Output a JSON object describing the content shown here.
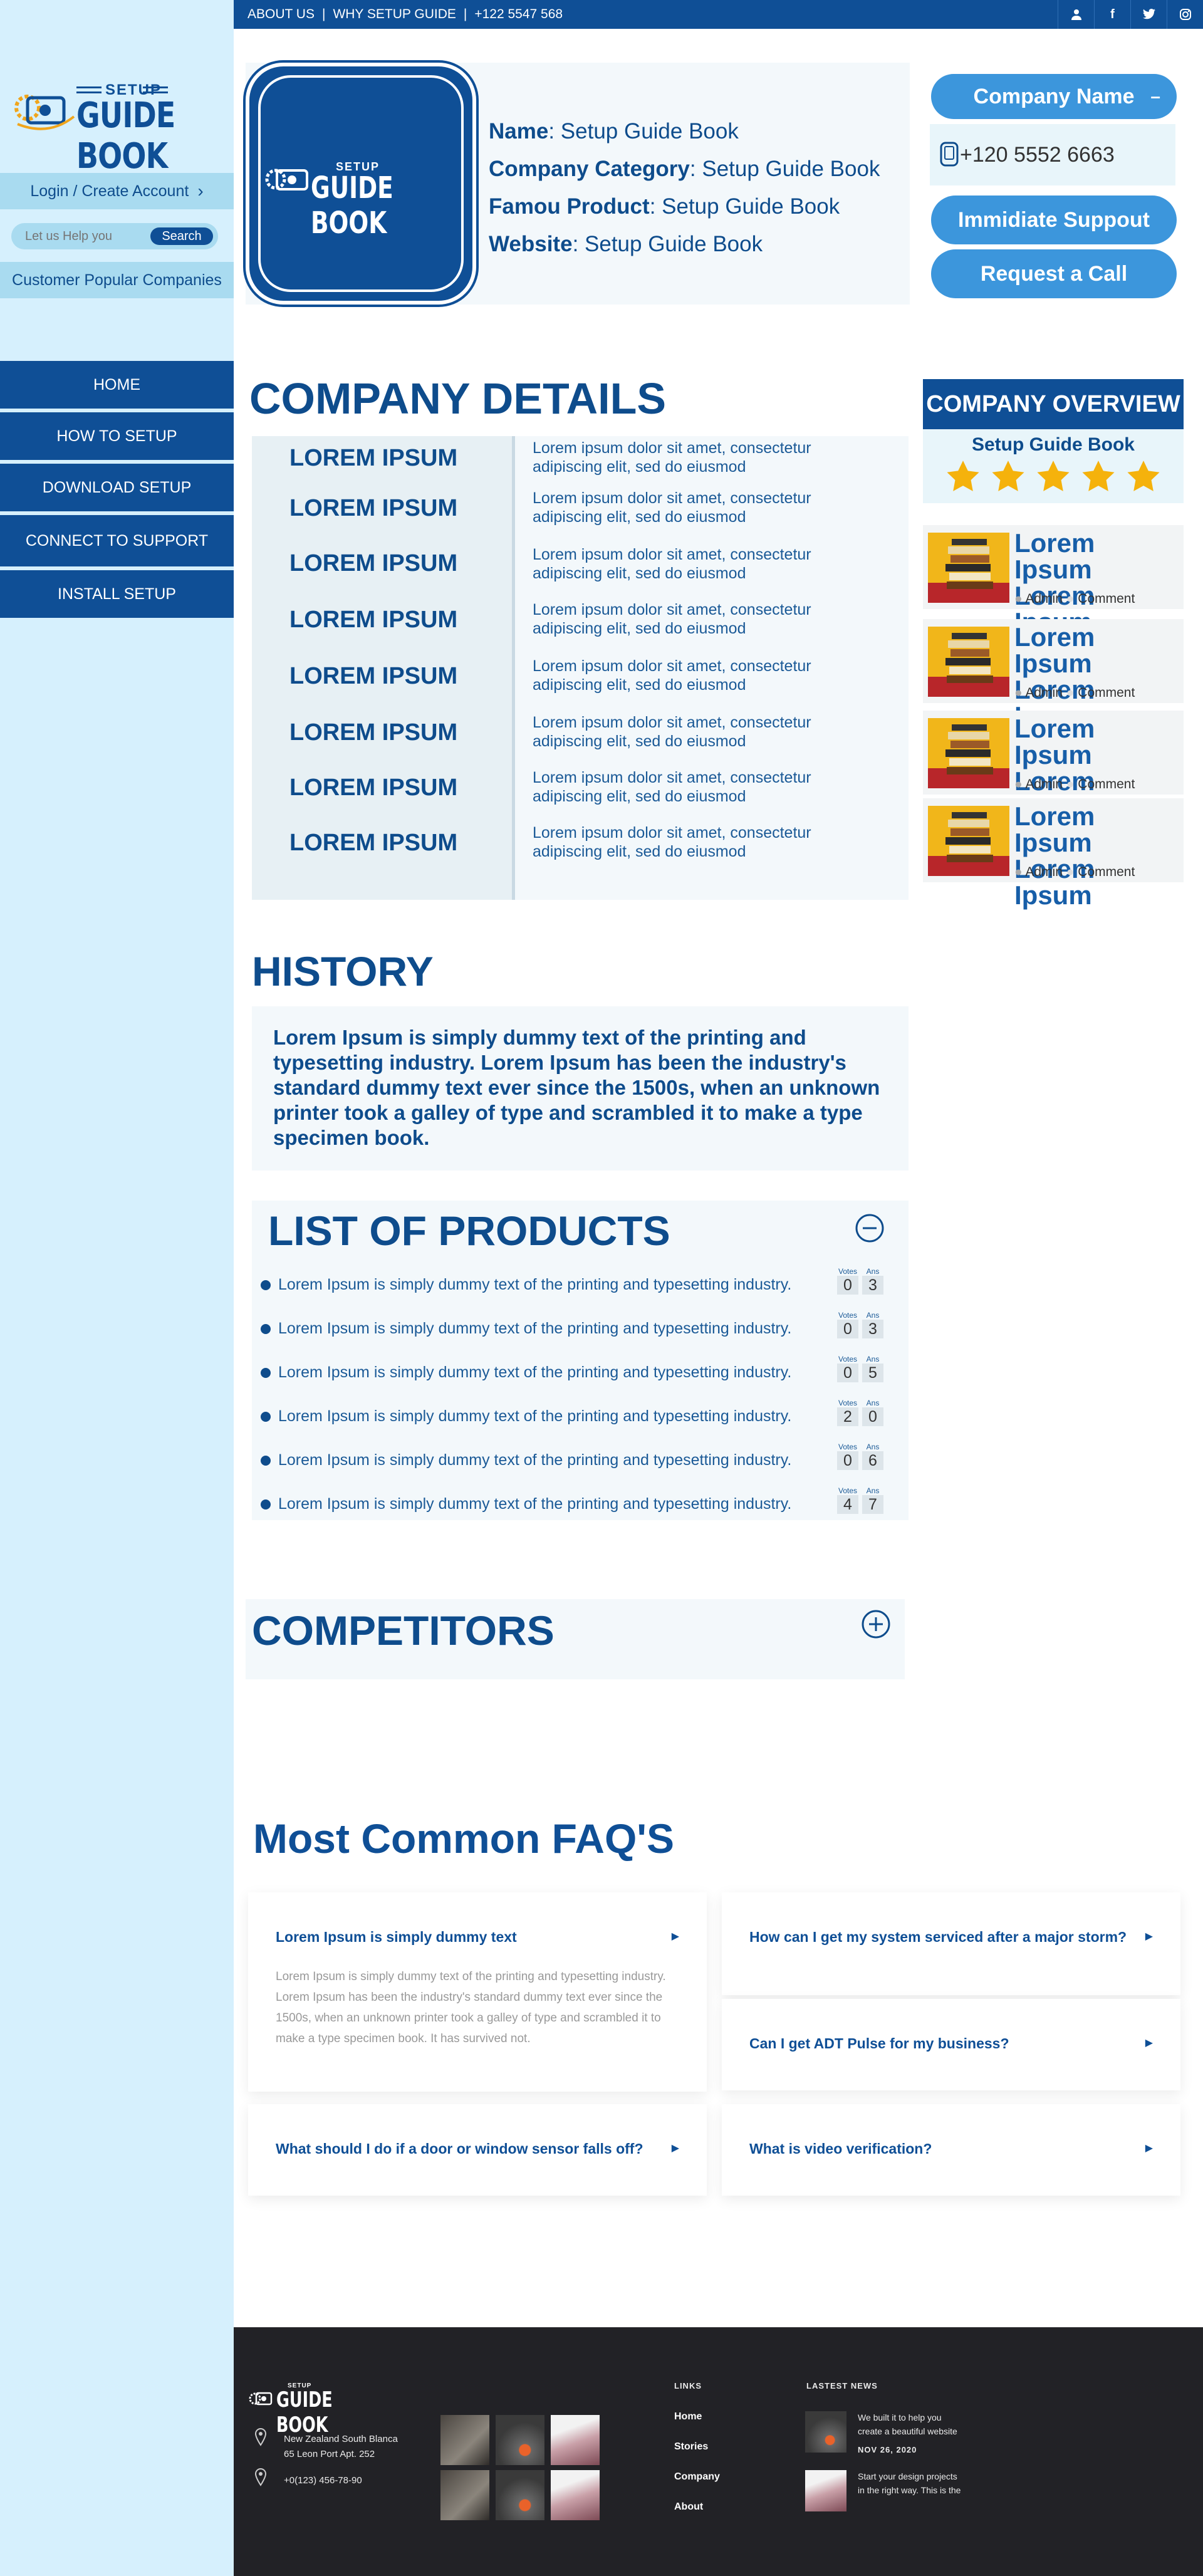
{
  "topbar": {
    "about": "ABOUT US",
    "sep": "|",
    "why": "WHY SETUP GUIDE",
    "phone": "+122 5547 568"
  },
  "brand": {
    "line1": "SETUP",
    "line2": "GUIDE BOOK"
  },
  "sidebar": {
    "login": "Login / Create Account",
    "search_placeholder": "Let us Help you",
    "search_button": "Search",
    "popular": "Customer Popular Companies",
    "nav": [
      "HOME",
      "HOW TO SETUP",
      "DOWNLOAD SETUP",
      "CONNECT TO SUPPORT",
      "INSTALL SETUP"
    ]
  },
  "profile": {
    "name_label": "Name",
    "name": "Setup Guide Book",
    "category_label": "Company Category",
    "category": "Setup Guide Book",
    "product_label": "Famou Product",
    "product": "Setup Guide Book",
    "website_label": "Website",
    "website": "Setup Guide Book"
  },
  "right_panel": {
    "company_name": "Company Name",
    "company_name_toggle": "–",
    "phone": "+120 5552 6663",
    "support_button": "Immidiate Suppout",
    "call_button": "Request a Call"
  },
  "details": {
    "title": "COMPANY DETAILS",
    "rows": [
      {
        "label": "LOREM IPSUM",
        "text": "Lorem ipsum dolor sit amet, consectetur adipiscing elit, sed do eiusmod"
      },
      {
        "label": "LOREM IPSUM",
        "text": "Lorem ipsum dolor sit amet, consectetur adipiscing elit, sed do eiusmod"
      },
      {
        "label": "LOREM IPSUM",
        "text": "Lorem ipsum dolor sit amet, consectetur adipiscing elit, sed do eiusmod"
      },
      {
        "label": "LOREM IPSUM",
        "text": "Lorem ipsum dolor sit amet, consectetur adipiscing elit, sed do eiusmod"
      },
      {
        "label": "LOREM IPSUM",
        "text": "Lorem ipsum dolor sit amet, consectetur adipiscing elit, sed do eiusmod"
      },
      {
        "label": "LOREM IPSUM",
        "text": "Lorem ipsum dolor sit amet, consectetur adipiscing elit, sed do eiusmod"
      },
      {
        "label": "LOREM IPSUM",
        "text": "Lorem ipsum dolor sit amet, consectetur adipiscing elit, sed do eiusmod"
      },
      {
        "label": "LOREM IPSUM",
        "text": "Lorem ipsum dolor sit amet, consectetur adipiscing elit, sed do eiusmod"
      }
    ]
  },
  "overview": {
    "title": "COMPANY OVERVIEW",
    "subtitle": "Setup Guide Book",
    "rating": 5,
    "star_color": "#f5b20c",
    "posts": [
      {
        "title": "Lorem Ipsum Lorem Ipsum",
        "author": "Admin",
        "comment": "Comment"
      },
      {
        "title": "Lorem Ipsum Lorem Ipsum",
        "author": "Admin",
        "comment": "Comment"
      },
      {
        "title": "Lorem Ipsum Lorem Ipsum",
        "author": "Admin",
        "comment": "Comment"
      },
      {
        "title": "Lorem Ipsum Lorem Ipsum",
        "author": "Admin",
        "comment": "Comment"
      }
    ]
  },
  "history": {
    "title": "HISTORY",
    "text": "Lorem Ipsum is simply dummy text of the printing and typesetting industry. Lorem Ipsum has been the industry's standard dummy text ever since the 1500s, when an unknown printer took a galley of type and scrambled it to make a type specimen book."
  },
  "products": {
    "title": "LIST OF PRODUCTS",
    "votes_label": "Votes",
    "ans_label": "Ans",
    "items": [
      {
        "text": "Lorem Ipsum is simply dummy text of the printing and typesetting industry.",
        "votes": "0",
        "ans": "3"
      },
      {
        "text": "Lorem Ipsum is simply dummy text of the printing and typesetting industry.",
        "votes": "0",
        "ans": "3"
      },
      {
        "text": "Lorem Ipsum is simply dummy text of the printing and typesetting industry.",
        "votes": "0",
        "ans": "5"
      },
      {
        "text": "Lorem Ipsum is simply dummy text of the printing and typesetting industry.",
        "votes": "2",
        "ans": "0"
      },
      {
        "text": "Lorem Ipsum is simply dummy text of the printing and typesetting industry.",
        "votes": "0",
        "ans": "6"
      },
      {
        "text": "Lorem Ipsum is simply dummy text of the printing and typesetting industry.",
        "votes": "4",
        "ans": "7"
      }
    ]
  },
  "competitors": {
    "title": "COMPETITORS"
  },
  "faq": {
    "title": "Most Common FAQ'S",
    "items": [
      {
        "q": "Lorem Ipsum is simply dummy text",
        "a": "Lorem Ipsum is simply dummy text of the printing and typesetting industry. Lorem Ipsum has been the industry's standard dummy text ever since the 1500s, when an unknown printer took a galley of type and scrambled it to make a type specimen book. It has survived not."
      },
      {
        "q": "How can I get my system serviced after a major storm?"
      },
      {
        "q": "Can I get ADT Pulse for my business?"
      },
      {
        "q": "What should I do if a door or window sensor falls off?"
      },
      {
        "q": "What is video verification?"
      }
    ]
  },
  "footer": {
    "address1": "New Zealand South Blanca",
    "address2": "65 Leon Port Apt. 252",
    "phone": "+0(123) 456-78-90",
    "links_title": "LINKS",
    "links": [
      "Home",
      "Stories",
      "Company",
      "About"
    ],
    "news_title": "LASTEST NEWS",
    "news": [
      {
        "text1": "We built it to help you",
        "text2": "create a beautiful website",
        "date": "NOV 26, 2020"
      },
      {
        "text1": "Start your design projects",
        "text2": "in the right way. This is the"
      }
    ]
  },
  "colors": {
    "primary": "#0f4f96",
    "accent": "#3c96dc",
    "sidebar_bg": "#d6f0fd",
    "footer_bg": "#222226"
  }
}
